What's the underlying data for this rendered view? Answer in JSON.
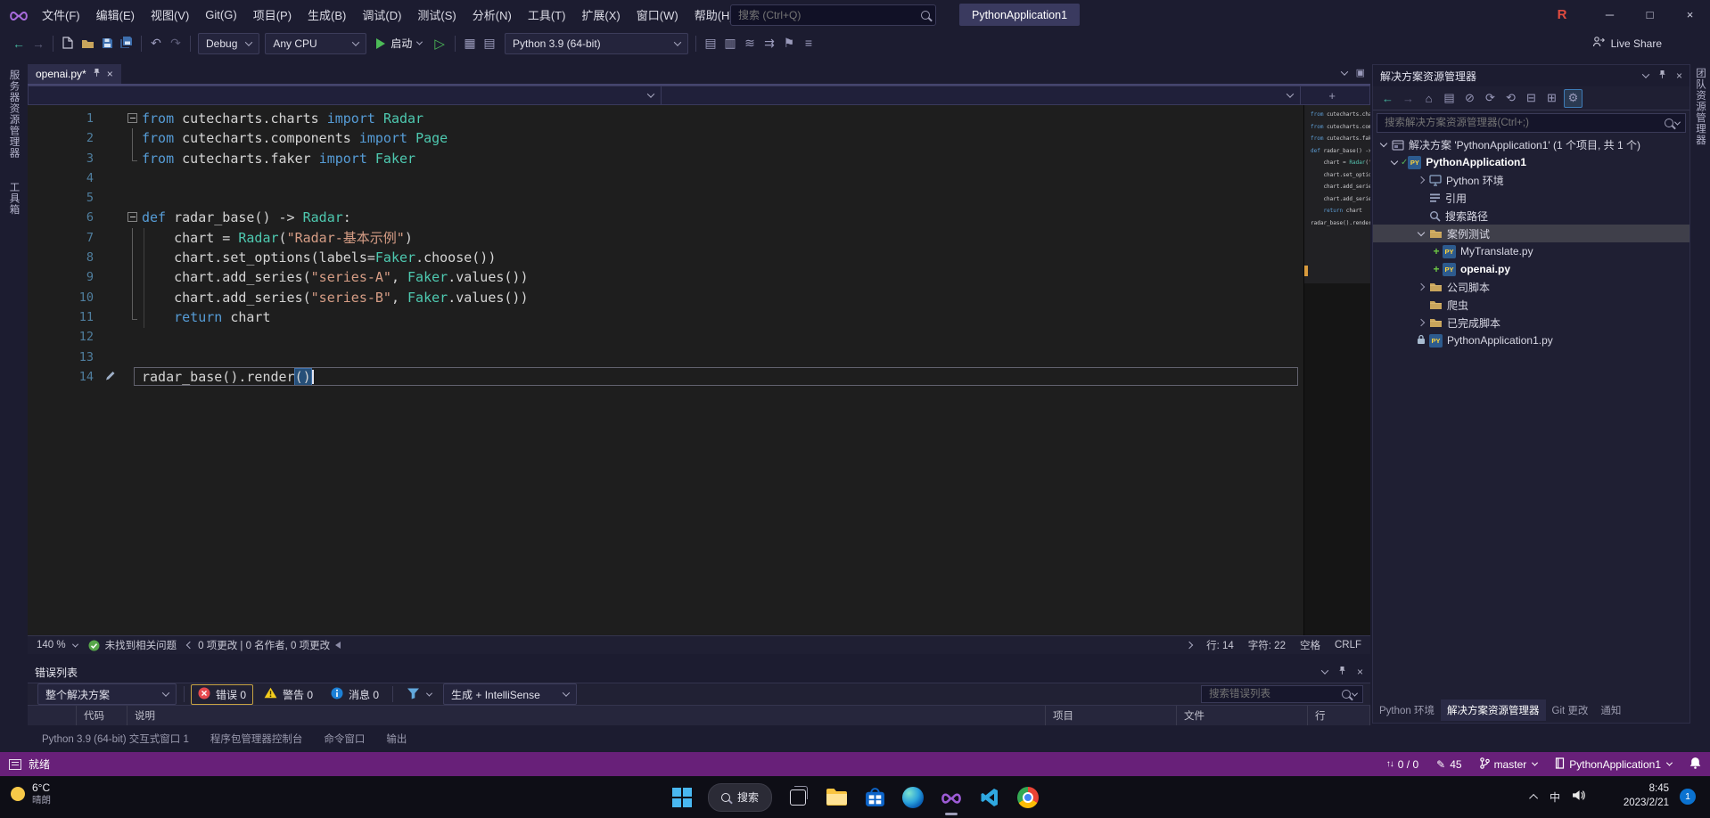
{
  "colors": {
    "accent_purple": "#68217A",
    "titlebar_bg": "#1C1C30",
    "editor_bg": "#1E1E1E",
    "keyword_blue": "#569CD6",
    "type_teal": "#4EC9B0",
    "string_salmon": "#D69D85",
    "error_red": "#E5484D",
    "warning_yellow": "#F2CB1D",
    "info_blue": "#1C80D6",
    "folder_tan": "#C9A55C",
    "start_green": "#4CBB57"
  },
  "title_bar": {
    "menus": [
      "文件(F)",
      "编辑(E)",
      "视图(V)",
      "Git(G)",
      "项目(P)",
      "生成(B)",
      "调试(D)",
      "测试(S)",
      "分析(N)",
      "工具(T)",
      "扩展(X)",
      "窗口(W)",
      "帮助(H)"
    ],
    "search_placeholder": "搜索 (Ctrl+Q)",
    "solution_chip": "PythonApplication1"
  },
  "toolbar": {
    "debug_target": "Debug",
    "platform": "Any CPU",
    "start_label": "启动",
    "python_env": "Python 3.9 (64-bit)",
    "live_share": "Live Share",
    "icons": {
      "nav": [
        "back-icon",
        "forward-icon"
      ],
      "file": [
        "new-file-icon",
        "open-file-icon",
        "save-icon",
        "save-all-icon"
      ],
      "edit": [
        "undo-icon",
        "redo-icon"
      ],
      "run_extra": [
        "window-grid-icon",
        "checklist-icon"
      ],
      "right": [
        "package-icon",
        "columns-icon",
        "profiler-icon",
        "navigate-icon",
        "bookmark-icon",
        "overflow-icon"
      ]
    }
  },
  "left_strip": {
    "tabs": [
      "服务器资源管理器",
      "工具箱"
    ]
  },
  "right_strip": {
    "tabs": [
      "团队资源管理器"
    ]
  },
  "editor": {
    "tab_title": "openai.py*",
    "status": {
      "zoom": "140 %",
      "health": "未找到相关问题",
      "changes": "0 项更改 | 0 名作者, 0 项更改",
      "line": "行: 14",
      "column": "字符: 22",
      "space": "空格",
      "eol": "CRLF"
    },
    "lines": [
      {
        "n": 1,
        "fold": true,
        "tok": [
          [
            "k",
            "from"
          ],
          [
            "p",
            " cutecharts.charts "
          ],
          [
            "k",
            "import"
          ],
          [
            "p",
            " "
          ],
          [
            "t",
            "Radar"
          ]
        ]
      },
      {
        "n": 2,
        "g": "mid",
        "tok": [
          [
            "k",
            "from"
          ],
          [
            "p",
            " cutecharts.components "
          ],
          [
            "k",
            "import"
          ],
          [
            "p",
            " "
          ],
          [
            "t",
            "Page"
          ]
        ]
      },
      {
        "n": 3,
        "g": "end",
        "tok": [
          [
            "k",
            "from"
          ],
          [
            "p",
            " cutecharts.faker "
          ],
          [
            "k",
            "import"
          ],
          [
            "p",
            " "
          ],
          [
            "t",
            "Faker"
          ]
        ]
      },
      {
        "n": 4,
        "tok": []
      },
      {
        "n": 5,
        "tok": []
      },
      {
        "n": 6,
        "fold": true,
        "tok": [
          [
            "k",
            "def"
          ],
          [
            "p",
            " radar_base() -> "
          ],
          [
            "t",
            "Radar"
          ],
          [
            "p",
            ":"
          ]
        ]
      },
      {
        "n": 7,
        "g": "mid",
        "tok": [
          [
            "p",
            "    chart = "
          ],
          [
            "t",
            "Radar"
          ],
          [
            "p",
            "("
          ],
          [
            "s",
            "\"Radar-基本示例\""
          ],
          [
            "p",
            ")"
          ]
        ]
      },
      {
        "n": 8,
        "g": "mid",
        "tok": [
          [
            "p",
            "    chart.set_options(labels="
          ],
          [
            "t",
            "Faker"
          ],
          [
            "p",
            ".choose())"
          ]
        ]
      },
      {
        "n": 9,
        "g": "mid",
        "tok": [
          [
            "p",
            "    chart.add_series("
          ],
          [
            "s",
            "\"series-A\""
          ],
          [
            "p",
            ", "
          ],
          [
            "t",
            "Faker"
          ],
          [
            "p",
            ".values())"
          ]
        ]
      },
      {
        "n": 10,
        "g": "mid",
        "tok": [
          [
            "p",
            "    chart.add_series("
          ],
          [
            "s",
            "\"series-B\""
          ],
          [
            "p",
            ", "
          ],
          [
            "t",
            "Faker"
          ],
          [
            "p",
            ".values())"
          ]
        ]
      },
      {
        "n": 11,
        "g": "end",
        "tok": [
          [
            "p",
            "    "
          ],
          [
            "k",
            "return"
          ],
          [
            "p",
            " chart"
          ]
        ]
      },
      {
        "n": 12,
        "tok": []
      },
      {
        "n": 13,
        "tok": []
      },
      {
        "n": 14,
        "pen": true,
        "caret": true,
        "current": true,
        "tok": [
          [
            "p",
            "radar_base().render"
          ],
          [
            "b",
            "()"
          ]
        ]
      }
    ]
  },
  "error_list": {
    "title": "错误列表",
    "scope": "整个解决方案",
    "errors_label": "错误 0",
    "warnings_label": "警告 0",
    "messages_label": "消息 0",
    "source_filter": "生成 + IntelliSense",
    "search_placeholder": "搜索错误列表",
    "columns": [
      "代码",
      "说明",
      "项目",
      "文件",
      "行"
    ]
  },
  "bottom_panel_tabs": [
    "Python 3.9 (64-bit) 交互式窗口 1",
    "程序包管理器控制台",
    "命令窗口",
    "输出"
  ],
  "solution_explorer": {
    "title": "解决方案资源管理器",
    "search_placeholder": "搜索解决方案资源管理器(Ctrl+;)",
    "toolbar_icons": [
      "back-icon",
      "forward-icon",
      "home-icon",
      "switch-views-icon",
      "scope-icon",
      "sync-icon",
      "refresh-icon",
      "collapse-all-icon",
      "show-all-files-icon",
      "properties-icon"
    ],
    "tree": [
      {
        "label": "解决方案 'PythonApplication1' (1 个项目, 共 1 个)",
        "level": 0,
        "arrow": "open",
        "icon": "solution"
      },
      {
        "label": "PythonApplication1",
        "level": 1,
        "arrow": "open",
        "icon": "py-project",
        "bold": true,
        "check": true
      },
      {
        "label": "Python 环境",
        "level": 2,
        "arrow": "closed",
        "icon": "env"
      },
      {
        "label": "引用",
        "level": 2,
        "icon": "refs"
      },
      {
        "label": "搜索路径",
        "level": 2,
        "icon": "search-path"
      },
      {
        "label": "案例测试",
        "level": 2,
        "arrow": "open",
        "icon": "folder",
        "selected": true
      },
      {
        "label": "MyTranslate.py",
        "level": 3,
        "prefix": "+",
        "icon": "py-file"
      },
      {
        "label": "openai.py",
        "level": 3,
        "prefix": "+",
        "icon": "py-file",
        "bold": true
      },
      {
        "label": "公司脚本",
        "level": 2,
        "arrow": "closed",
        "icon": "folder"
      },
      {
        "label": "爬虫",
        "level": 2,
        "icon": "folder"
      },
      {
        "label": "已完成脚本",
        "level": 2,
        "arrow": "closed",
        "icon": "folder"
      },
      {
        "label": "PythonApplication1.py",
        "level": 2,
        "lock": true,
        "icon": "py-file"
      }
    ],
    "bottom_tabs": [
      {
        "label": "Python 环境"
      },
      {
        "label": "解决方案资源管理器",
        "active": true
      },
      {
        "label": "Git 更改"
      },
      {
        "label": "通知"
      }
    ]
  },
  "status_bar": {
    "ready": "就绪",
    "sync_count": "0 / 0",
    "edit_count": "45",
    "branch": "master",
    "repo": "PythonApplication1"
  },
  "taskbar": {
    "weather_temp": "6°C",
    "weather_desc": "晴朗",
    "search_label": "搜索",
    "tray_ime": "中",
    "clock_time": "8:45",
    "clock_date": "2023/2/21",
    "notification_badge": "1"
  }
}
